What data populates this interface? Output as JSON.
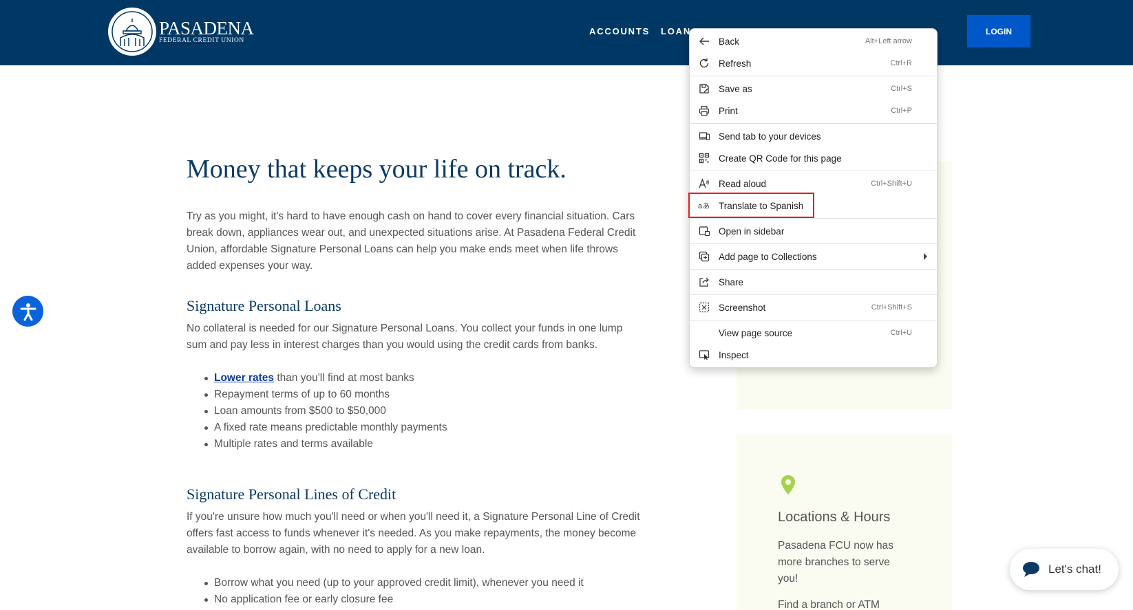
{
  "header": {
    "logo_name": "PASADENA",
    "logo_sub": "FEDERAL CREDIT UNION",
    "nav": [
      "ACCOUNTS",
      "LOAN"
    ],
    "login_label": "LOGIN",
    "bg_color": "#003865"
  },
  "main": {
    "title": "Money that keeps your life on track.",
    "intro": "Try as you might, it's hard to have enough cash on hand to cover every financial situation. Cars break down, appliances wear out, and unexpected situations arise. At Pasadena Federal Credit Union, affordable Signature Personal Loans can help you make ends meet when life throws added expenses your way.",
    "loans_title": "Signature Personal Loans",
    "loans_text": "No collateral is needed for our Signature Personal Loans. You collect your funds in one lump sum and pay less in interest charges than you would using the credit cards from banks.",
    "loans_bullets": {
      "first_link": "Lower rates",
      "first_rest": " than you'll find at most banks",
      "items": [
        "Repayment terms of up to 60 months",
        "Loan amounts from $500 to $50,000",
        "A fixed rate means predictable monthly payments",
        "Multiple rates and terms available"
      ]
    },
    "credit_title": "Signature Personal Lines of Credit",
    "credit_text": "If you're unsure how much you'll need or when you'll need it, a Signature Personal Line of Credit offers fast access to funds whenever it's needed. As you make repayments, the money become available to borrow again, with no need to apply for a new loan.",
    "credit_bullets": [
      "Borrow what you need (up to your approved credit limit), whenever you need it",
      "No application fee or early closure fee"
    ]
  },
  "sidebar": {
    "locations_title": "Locations & Hours",
    "locations_text": "Pasadena FCU now has more branches to serve you!",
    "locations_link": "Find a branch or ATM"
  },
  "chat": {
    "label": "Let's chat!"
  },
  "context_menu": {
    "items": [
      {
        "label": "Back",
        "shortcut": "Alt+Left arrow",
        "icon": "back-arrow-icon"
      },
      {
        "label": "Refresh",
        "shortcut": "Ctrl+R",
        "icon": "refresh-icon"
      },
      {
        "label": "Save as",
        "shortcut": "Ctrl+S",
        "icon": "save-icon"
      },
      {
        "label": "Print",
        "shortcut": "Ctrl+P",
        "icon": "print-icon"
      },
      {
        "label": "Send tab to your devices",
        "shortcut": "",
        "icon": "devices-icon"
      },
      {
        "label": "Create QR Code for this page",
        "shortcut": "",
        "icon": "qr-code-icon"
      },
      {
        "label": "Read aloud",
        "shortcut": "Ctrl+Shift+U",
        "icon": "read-aloud-icon"
      },
      {
        "label": "Translate to Spanish",
        "shortcut": "",
        "icon": "translate-icon"
      },
      {
        "label": "Open in sidebar",
        "shortcut": "",
        "icon": "sidebar-icon"
      },
      {
        "label": "Add page to Collections",
        "shortcut": "",
        "icon": "collections-icon"
      },
      {
        "label": "Share",
        "shortcut": "",
        "icon": "share-icon"
      },
      {
        "label": "Screenshot",
        "shortcut": "Ctrl+Shift+S",
        "icon": "screenshot-icon"
      },
      {
        "label": "View page source",
        "shortcut": "Ctrl+U",
        "icon": ""
      },
      {
        "label": "Inspect",
        "shortcut": "",
        "icon": "inspect-icon"
      }
    ],
    "highlight_color": "#e02020"
  }
}
